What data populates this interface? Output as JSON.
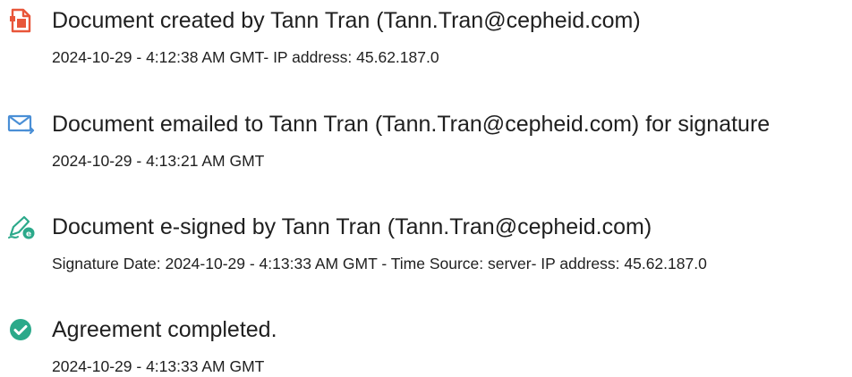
{
  "events": [
    {
      "icon": "document-created-icon",
      "icon_color": "#e8563a",
      "title": "Document created by Tann Tran (Tann.Tran@cepheid.com)",
      "detail": "2024-10-29 - 4:12:38 AM GMT- IP address: 45.62.187.0"
    },
    {
      "icon": "email-sent-icon",
      "icon_color": "#4a8fd6",
      "title": "Document emailed to Tann Tran (Tann.Tran@cepheid.com) for signature",
      "detail": "2024-10-29 - 4:13:21 AM GMT"
    },
    {
      "icon": "e-sign-pen-icon",
      "icon_color": "#2ba98a",
      "title": "Document e-signed by Tann Tran (Tann.Tran@cepheid.com)",
      "detail": "Signature Date: 2024-10-29 - 4:13:33 AM GMT - Time Source: server- IP address: 45.62.187.0"
    },
    {
      "icon": "check-circle-icon",
      "icon_color": "#2ba98a",
      "title": "Agreement completed.",
      "detail": "2024-10-29 - 4:13:33 AM GMT"
    }
  ]
}
